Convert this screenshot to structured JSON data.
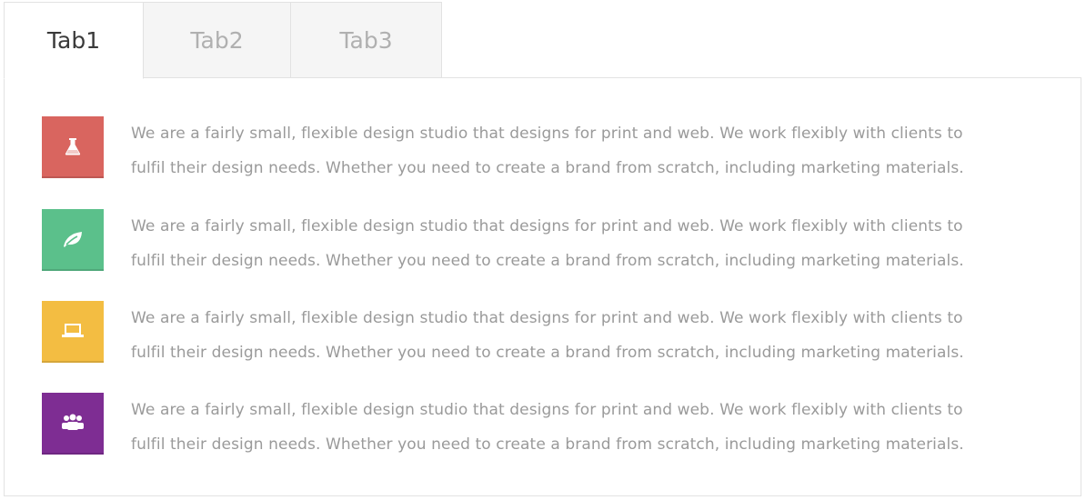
{
  "tabs": [
    {
      "label": "Tab1",
      "active": true
    },
    {
      "label": "Tab2",
      "active": false
    },
    {
      "label": "Tab3",
      "active": false
    }
  ],
  "items": [
    {
      "icon": "flask-icon",
      "color": "#d9655f",
      "line1": "We are a fairly small, flexible design studio that designs for print and web. We work flexibly with clients to",
      "line2": "fulfil their design needs. Whether you need to create a brand from scratch, including marketing materials."
    },
    {
      "icon": "leaf-icon",
      "color": "#5bc08b",
      "line1": "We are a fairly small, flexible design studio that designs for print and web. We work flexibly with clients to",
      "line2": "fulfil their design needs. Whether you need to create a brand from scratch, including marketing materials."
    },
    {
      "icon": "laptop-icon",
      "color": "#f3bd42",
      "line1": "We are a fairly small, flexible design studio that designs for print and web. We work flexibly with clients to",
      "line2": "fulfil their design needs. Whether you need to create a brand from scratch, including marketing materials."
    },
    {
      "icon": "users-icon",
      "color": "#7e2d93",
      "line1": "We are a fairly small, flexible design studio that designs for print and web. We work flexibly with clients to",
      "line2": "fulfil their design needs. Whether you need to create a brand from scratch, including marketing materials."
    }
  ]
}
